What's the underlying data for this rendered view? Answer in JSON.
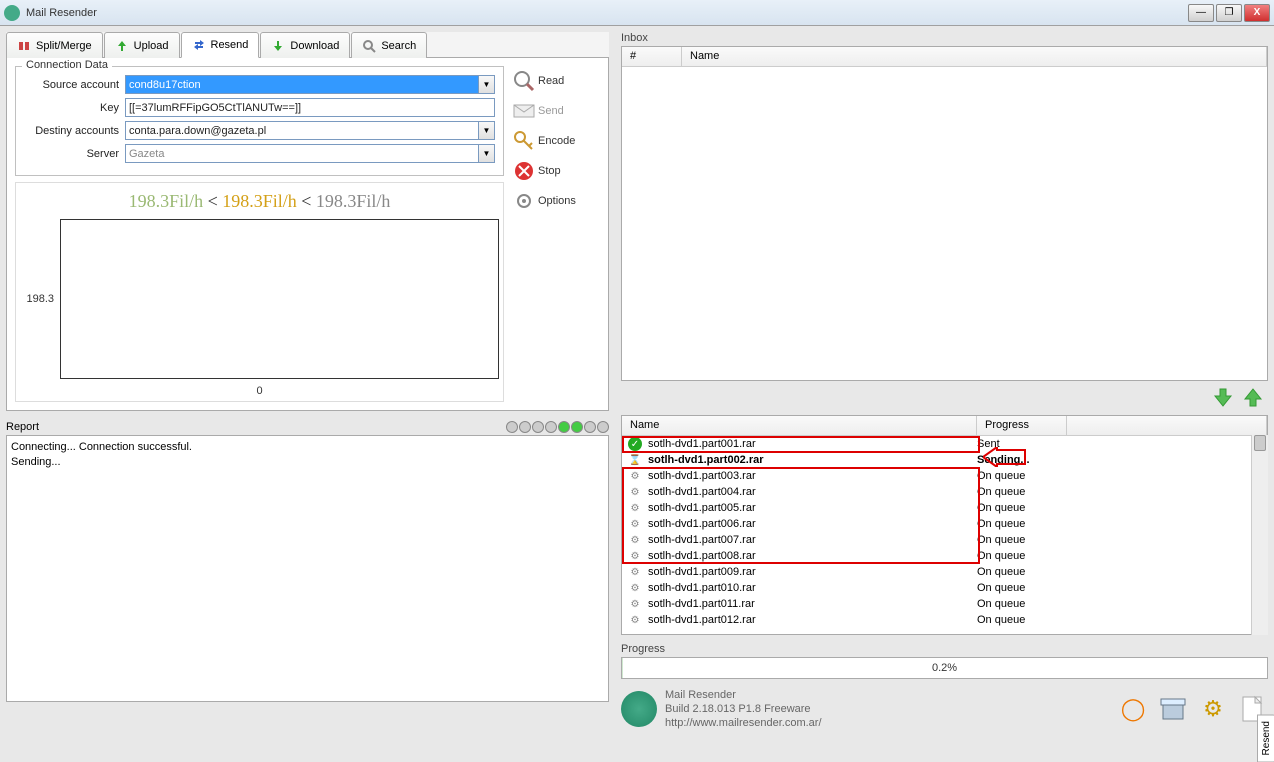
{
  "app_title": "Mail Resender",
  "tabs": {
    "split": "Split/Merge",
    "upload": "Upload",
    "resend": "Resend",
    "download": "Download",
    "search": "Search"
  },
  "conn": {
    "legend": "Connection Data",
    "source_label": "Source account",
    "source_value": "cond8u17ction",
    "key_label": "Key",
    "key_value": "[[=37lumRFFipGO5CtTlANUTw==]]",
    "dest_label": "Destiny accounts",
    "dest_value": "conta.para.down@gazeta.pl",
    "server_label": "Server",
    "server_value": "Gazeta"
  },
  "actions": {
    "read": "Read",
    "send": "Send",
    "encode": "Encode",
    "stop": "Stop",
    "options": "Options"
  },
  "rate": {
    "a": "198.3Fil/h",
    "lt1": " < ",
    "b": "198.3Fil/h",
    "lt2": " < ",
    "c": "198.3Fil/h"
  },
  "chart_y": "198.3",
  "chart_x": "0",
  "report": {
    "label": "Report",
    "text": "Connecting... Connection successful.\nSending..."
  },
  "inbox": {
    "label": "Inbox",
    "col_num": "#",
    "col_name": "Name"
  },
  "queue": {
    "col_name": "Name",
    "col_prog": "Progress",
    "rows": [
      {
        "icon": "ok",
        "name": "sotlh-dvd1.part001.rar",
        "prog": "Sent",
        "bold": false
      },
      {
        "icon": "hg",
        "name": "sotlh-dvd1.part002.rar",
        "prog": "Sending...",
        "bold": true
      },
      {
        "icon": "gear",
        "name": "sotlh-dvd1.part003.rar",
        "prog": "On queue",
        "bold": false
      },
      {
        "icon": "gear",
        "name": "sotlh-dvd1.part004.rar",
        "prog": "On queue",
        "bold": false
      },
      {
        "icon": "gear",
        "name": "sotlh-dvd1.part005.rar",
        "prog": "On queue",
        "bold": false
      },
      {
        "icon": "gear",
        "name": "sotlh-dvd1.part006.rar",
        "prog": "On queue",
        "bold": false
      },
      {
        "icon": "gear",
        "name": "sotlh-dvd1.part007.rar",
        "prog": "On queue",
        "bold": false
      },
      {
        "icon": "gear",
        "name": "sotlh-dvd1.part008.rar",
        "prog": "On queue",
        "bold": false
      },
      {
        "icon": "gear",
        "name": "sotlh-dvd1.part009.rar",
        "prog": "On queue",
        "bold": false
      },
      {
        "icon": "gear",
        "name": "sotlh-dvd1.part010.rar",
        "prog": "On queue",
        "bold": false
      },
      {
        "icon": "gear",
        "name": "sotlh-dvd1.part011.rar",
        "prog": "On queue",
        "bold": false
      },
      {
        "icon": "gear",
        "name": "sotlh-dvd1.part012.rar",
        "prog": "On queue",
        "bold": false
      }
    ]
  },
  "progress": {
    "label": "Progress",
    "text": "0.2%",
    "value": 0.2
  },
  "footer": {
    "line1": "Mail Resender",
    "line2": "Build 2.18.013 P1.8 Freeware",
    "line3": "http://www.mailresender.com.ar/"
  },
  "side_tab": "Resend"
}
